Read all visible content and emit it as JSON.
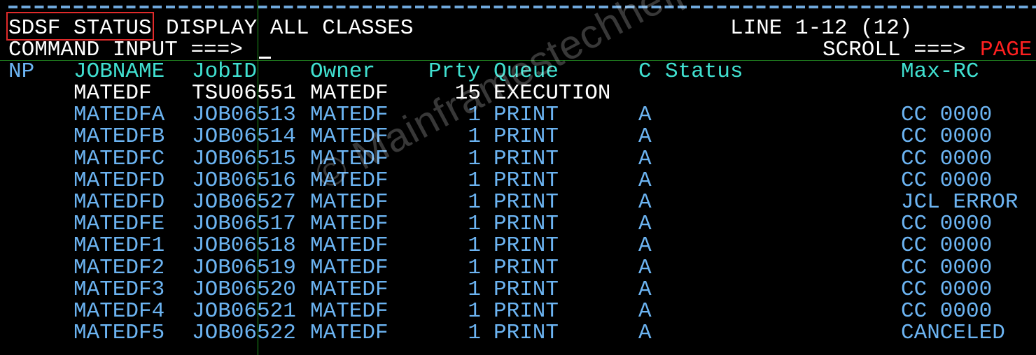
{
  "header": {
    "panel_label": "SDSF STATUS",
    "title_rest": "DISPLAY ALL CLASSES",
    "line_info": "LINE 1-12 (12)",
    "command_label": "COMMAND INPUT ===>",
    "command_value": "",
    "scroll_label": "SCROLL ===>",
    "scroll_value": "PAGE"
  },
  "columns": {
    "np": "NP",
    "jobname": "JOBNAME",
    "jobid": "JobID",
    "owner": "Owner",
    "prty": "Prty",
    "queue": "Queue",
    "c": "C",
    "status": "Status",
    "maxrc": "Max-RC"
  },
  "rows": [
    {
      "jobname": "MATEDF",
      "jobid": "TSU06551",
      "owner": "MATEDF",
      "prty": "15",
      "queue": "EXECUTION",
      "c": "",
      "status": "",
      "maxrc": "",
      "highlight": "white"
    },
    {
      "jobname": "MATEDFA",
      "jobid": "JOB06513",
      "owner": "MATEDF",
      "prty": "1",
      "queue": "PRINT",
      "c": "A",
      "status": "",
      "maxrc": "CC 0000",
      "highlight": "blue"
    },
    {
      "jobname": "MATEDFB",
      "jobid": "JOB06514",
      "owner": "MATEDF",
      "prty": "1",
      "queue": "PRINT",
      "c": "A",
      "status": "",
      "maxrc": "CC 0000",
      "highlight": "blue"
    },
    {
      "jobname": "MATEDFC",
      "jobid": "JOB06515",
      "owner": "MATEDF",
      "prty": "1",
      "queue": "PRINT",
      "c": "A",
      "status": "",
      "maxrc": "CC 0000",
      "highlight": "blue"
    },
    {
      "jobname": "MATEDFD",
      "jobid": "JOB06516",
      "owner": "MATEDF",
      "prty": "1",
      "queue": "PRINT",
      "c": "A",
      "status": "",
      "maxrc": "CC 0000",
      "highlight": "blue"
    },
    {
      "jobname": "MATEDFD",
      "jobid": "JOB06527",
      "owner": "MATEDF",
      "prty": "1",
      "queue": "PRINT",
      "c": "A",
      "status": "",
      "maxrc": "JCL ERROR",
      "highlight": "blue"
    },
    {
      "jobname": "MATEDFE",
      "jobid": "JOB06517",
      "owner": "MATEDF",
      "prty": "1",
      "queue": "PRINT",
      "c": "A",
      "status": "",
      "maxrc": "CC 0000",
      "highlight": "blue"
    },
    {
      "jobname": "MATEDF1",
      "jobid": "JOB06518",
      "owner": "MATEDF",
      "prty": "1",
      "queue": "PRINT",
      "c": "A",
      "status": "",
      "maxrc": "CC 0000",
      "highlight": "blue"
    },
    {
      "jobname": "MATEDF2",
      "jobid": "JOB06519",
      "owner": "MATEDF",
      "prty": "1",
      "queue": "PRINT",
      "c": "A",
      "status": "",
      "maxrc": "CC 0000",
      "highlight": "blue"
    },
    {
      "jobname": "MATEDF3",
      "jobid": "JOB06520",
      "owner": "MATEDF",
      "prty": "1",
      "queue": "PRINT",
      "c": "A",
      "status": "",
      "maxrc": "CC 0000",
      "highlight": "blue"
    },
    {
      "jobname": "MATEDF4",
      "jobid": "JOB06521",
      "owner": "MATEDF",
      "prty": "1",
      "queue": "PRINT",
      "c": "A",
      "status": "",
      "maxrc": "CC 0000",
      "highlight": "blue"
    },
    {
      "jobname": "MATEDF5",
      "jobid": "JOB06522",
      "owner": "MATEDF",
      "prty": "1",
      "queue": "PRINT",
      "c": "A",
      "status": "",
      "maxrc": "CANCELED",
      "highlight": "blue"
    }
  ],
  "watermark": "© Mainframestechhelp",
  "colors": {
    "text_default": "#ffffff",
    "header_columns": "#40e0d0",
    "data_rows": "#6cb4f2",
    "scroll_value": "#ff2020",
    "highlight_box": "#e02a2a",
    "divider_lines": "#1e9a1e"
  }
}
